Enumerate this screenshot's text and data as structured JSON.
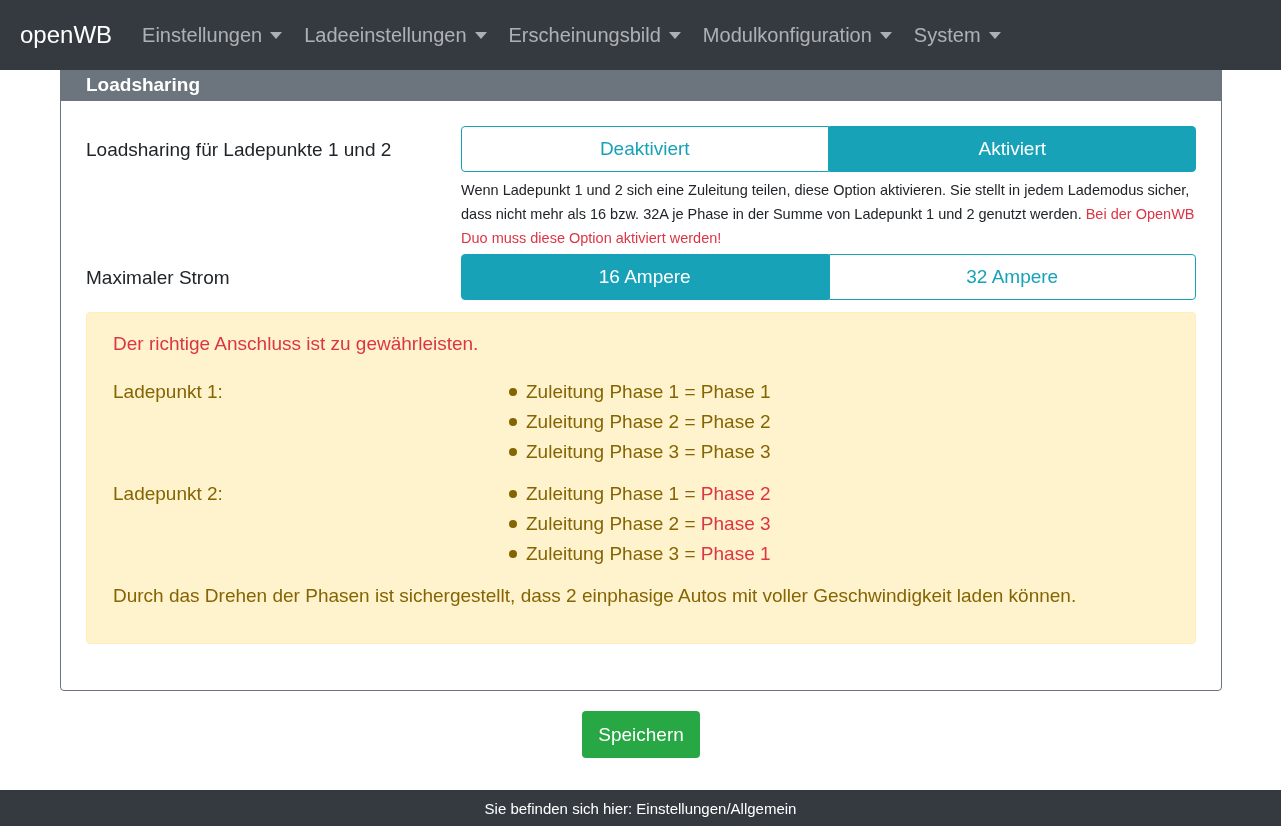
{
  "navbar": {
    "brand": "openWB",
    "menus": [
      {
        "label": "Einstellungen"
      },
      {
        "label": "Ladeeinstellungen"
      },
      {
        "label": "Erscheinungsbild"
      },
      {
        "label": "Modulkonfiguration"
      },
      {
        "label": "System"
      }
    ]
  },
  "card": {
    "title": "Loadsharing",
    "settings": [
      {
        "label": "Loadsharing für Ladepunkte 1 und 2",
        "options": [
          {
            "label": "Deaktiviert",
            "selected": false
          },
          {
            "label": "Aktiviert",
            "selected": true
          }
        ],
        "help": "Wenn Ladepunkt 1 und 2 sich eine Zuleitung teilen, diese Option aktivieren. Sie stellt in jedem Lademodus sicher, dass nicht mehr als 16 bzw. 32A je Phase in der Summe von Ladepunkt 1 und 2 genutzt werden.",
        "help_warning": "Bei der OpenWB Duo muss diese Option aktiviert werden!"
      },
      {
        "label": "Maximaler Strom",
        "options": [
          {
            "label": "16 Ampere",
            "selected": true
          },
          {
            "label": "32 Ampere",
            "selected": false
          }
        ]
      }
    ],
    "alert": {
      "warning": "Der richtige Anschluss ist zu gewährleisten.",
      "chargepoints": [
        {
          "label": "Ladepunkt 1:",
          "items": [
            {
              "text": "Zuleitung Phase 1 =",
              "value": "Phase 1",
              "highlighted": false
            },
            {
              "text": "Zuleitung Phase 2 =",
              "value": "Phase 2",
              "highlighted": false
            },
            {
              "text": "Zuleitung Phase 3 =",
              "value": "Phase 3",
              "highlighted": false
            }
          ]
        },
        {
          "label": "Ladepunkt 2:",
          "items": [
            {
              "text": "Zuleitung Phase 1 =",
              "value": "Phase 2",
              "highlighted": true
            },
            {
              "text": "Zuleitung Phase 2 =",
              "value": "Phase 3",
              "highlighted": true
            },
            {
              "text": "Zuleitung Phase 3 =",
              "value": "Phase 1",
              "highlighted": true
            }
          ]
        }
      ],
      "note": "Durch das Drehen der Phasen ist sichergestellt, dass 2 einphasige Autos mit voller Geschwindigkeit laden können."
    }
  },
  "save_button": "Speichern",
  "footer": "Sie befinden sich hier: Einstellungen/Allgemein"
}
